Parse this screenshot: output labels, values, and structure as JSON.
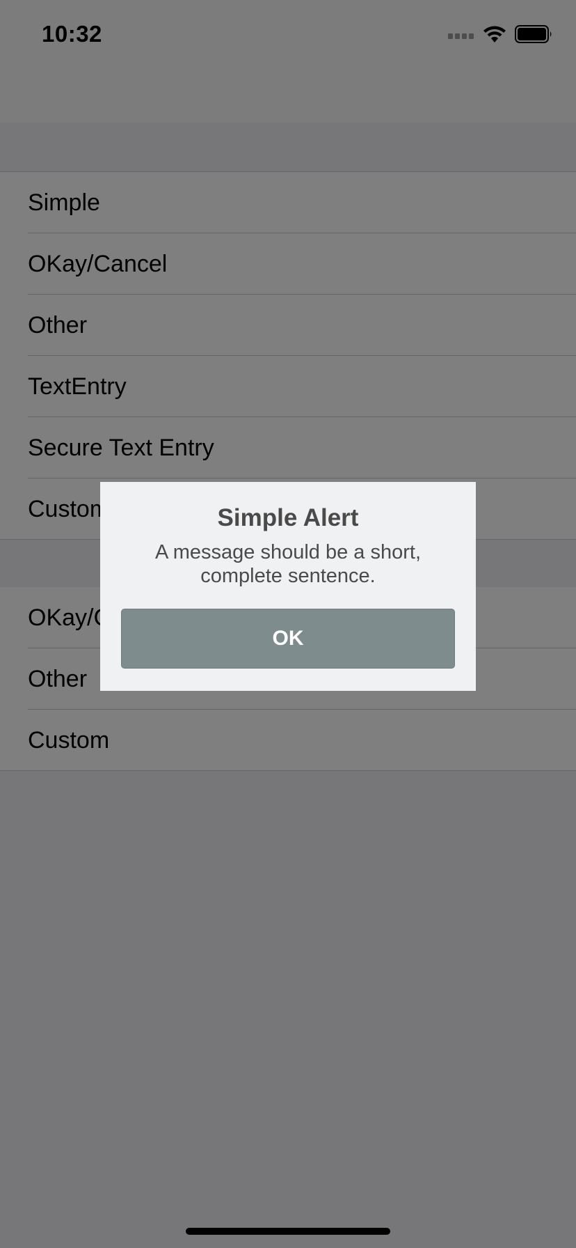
{
  "status_bar": {
    "time": "10:32",
    "signal_icon": "signal-bars-icon",
    "wifi_icon": "wifi-icon",
    "battery_icon": "battery-icon"
  },
  "list": {
    "section1": [
      {
        "label": "Simple"
      },
      {
        "label": "OKay/Cancel"
      },
      {
        "label": "Other"
      },
      {
        "label": "TextEntry"
      },
      {
        "label": "Secure Text Entry"
      },
      {
        "label": "Custom"
      }
    ],
    "section2": [
      {
        "label": "OKay/Cancel"
      },
      {
        "label": "Other"
      },
      {
        "label": "Custom"
      }
    ]
  },
  "alert": {
    "title": "Simple Alert",
    "message": "A message should be a short, complete sentence.",
    "ok_label": "OK",
    "ok_button_color": "#7f8c8d",
    "background_color": "#f0f1f3"
  }
}
